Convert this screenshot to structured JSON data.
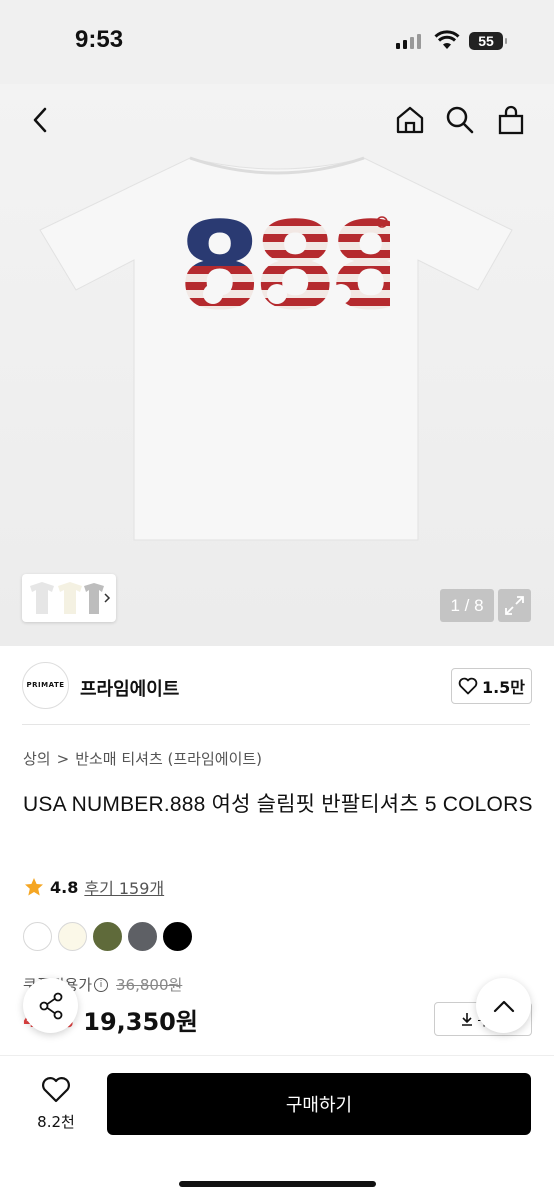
{
  "status_bar": {
    "time": "9:53",
    "battery": "55"
  },
  "gallery": {
    "pager": "1 / 8"
  },
  "brand": {
    "logo_text": "PRIMATE",
    "name": "프라임에이트",
    "like_count": "1.5만"
  },
  "breadcrumb": {
    "level1": "상의",
    "separator": ">",
    "level2": "반소매 티셔츠 (프라임에이트)"
  },
  "product": {
    "title": "USA NUMBER.888 여성 슬림핏 반팔티셔츠 5 COLORS",
    "rating": "4.8",
    "review_link": "후기 159개",
    "swatches": [
      "#ffffff",
      "#fbf8e8",
      "#5f6a3a",
      "#5e6065",
      "#000000"
    ],
    "coupon_label": "쿠폰적용가",
    "original_price": "36,800원",
    "discount": "47%",
    "price": "19,350원",
    "coupon_button": "쿠폰"
  },
  "bottom_bar": {
    "wish_count": "8.2천",
    "buy_label": "구매하기"
  },
  "colors": {
    "accent_star": "#f5a623",
    "discount": "#e04040",
    "buy_bg": "#000000"
  }
}
